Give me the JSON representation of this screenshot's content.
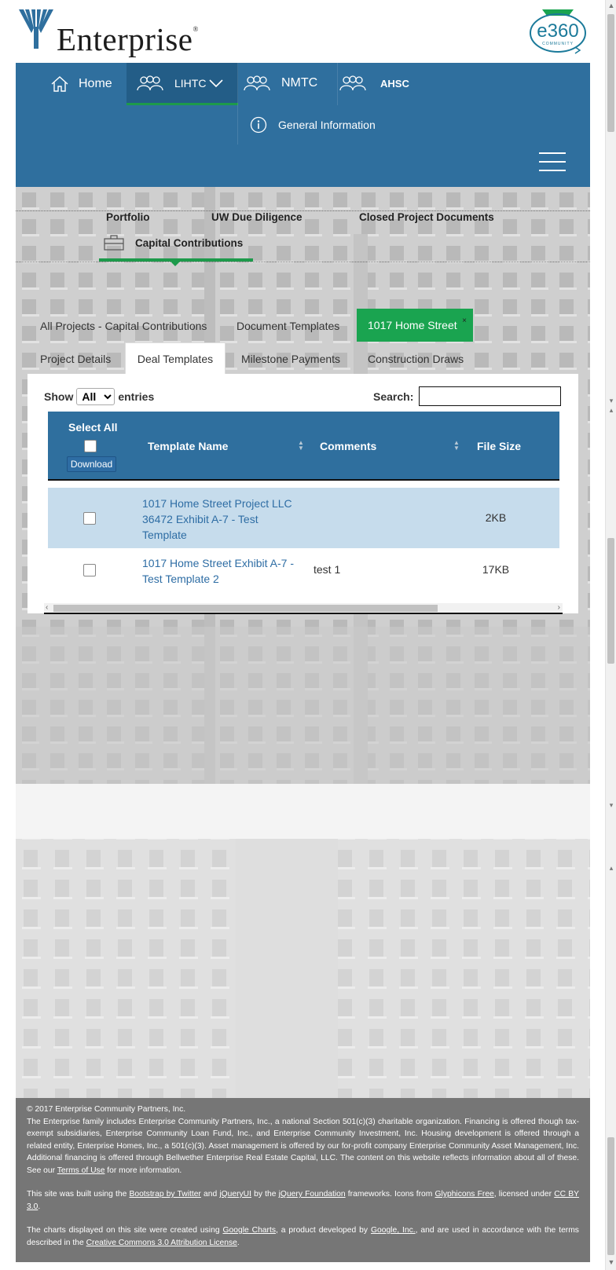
{
  "brand": {
    "name": "Enterprise",
    "mark": "®",
    "community_logo_text": "e360",
    "community_logo_sub": "COMMUNITY"
  },
  "nav": {
    "home": "Home",
    "lihtc": "LIHTC",
    "nmtc": "NMTC",
    "ahsc": "AHSC",
    "general_info": "General Information"
  },
  "subnav": {
    "portfolio": "Portfolio",
    "uw_due_diligence": "UW Due Diligence",
    "closed_project_documents": "Closed Project Documents",
    "capital_contributions": "Capital Contributions"
  },
  "tabs_top": {
    "all_projects": "All Projects - Capital Contributions",
    "document_templates": "Document Templates",
    "project": "1017 Home Street",
    "close_glyph": "×"
  },
  "tabs_sub": {
    "project_details": "Project Details",
    "deal_templates": "Deal Templates",
    "milestone_payments": "Milestone Payments",
    "construction_draws": "Construction Draws"
  },
  "table_controls": {
    "show": "Show",
    "entries": "entries",
    "selected_length": "All",
    "search_label": "Search:"
  },
  "table": {
    "select_all": "Select All",
    "download": "Download",
    "columns": [
      "Template Name",
      "Comments",
      "File Size"
    ],
    "rows": [
      {
        "name": "1017 Home Street Project LLC 36472 Exhibit A-7 - Test Template",
        "comment": "",
        "size": "2KB"
      },
      {
        "name": "1017 Home Street Exhibit A-7 - Test Template 2",
        "comment": "test 1",
        "size": "17KB"
      }
    ]
  },
  "footer": {
    "copyright": "© 2017 Enterprise Community Partners, Inc.",
    "p1": "The Enterprise family includes Enterprise Community Partners, Inc., a national Section 501(c)(3) charitable organization. Financing is offered though tax-exempt subsidiaries, Enterprise Community Loan Fund, Inc., and Enterprise Community Investment, Inc. Housing development is offered through a related entity, Enterprise Homes, Inc., a 501(c)(3). Asset management is offered by our for-profit company Enterprise Community Asset Management, Inc. Additional financing is offered through Bellwether Enterprise Real Estate Capital, LLC. The content on this website reflects information about all of these. See our",
    "terms_link": "Terms of Use",
    "p1_end": "for more information.",
    "p2_a": "This site was built using the",
    "bootstrap": "Bootstrap by Twitter",
    "p2_b": "and",
    "jqueryui": "jQueryUI",
    "p2_c": "by the",
    "jquery_foundation": "jQuery Foundation",
    "p2_d": "frameworks. Icons from",
    "glyphicons": "Glyphicons Free",
    "p2_e": ", licensed under",
    "ccby": "CC BY 3.0",
    "p2_f": ".",
    "p3_a": "The charts displayed on this site were created using",
    "google_charts": "Google Charts",
    "p3_b": ", a product developed by",
    "google_inc": "Google, Inc.",
    "p3_c": ", and are used in accordance with the terms described in the",
    "cc_license": "Creative Commons 3.0 Attribution License",
    "p3_d": "."
  },
  "colors": {
    "nav_blue": "#2f6f9e",
    "accent_green": "#1aa450",
    "link_blue": "#2e6da4",
    "row_highlight": "#c6dcec",
    "footer_gray": "#767676"
  }
}
